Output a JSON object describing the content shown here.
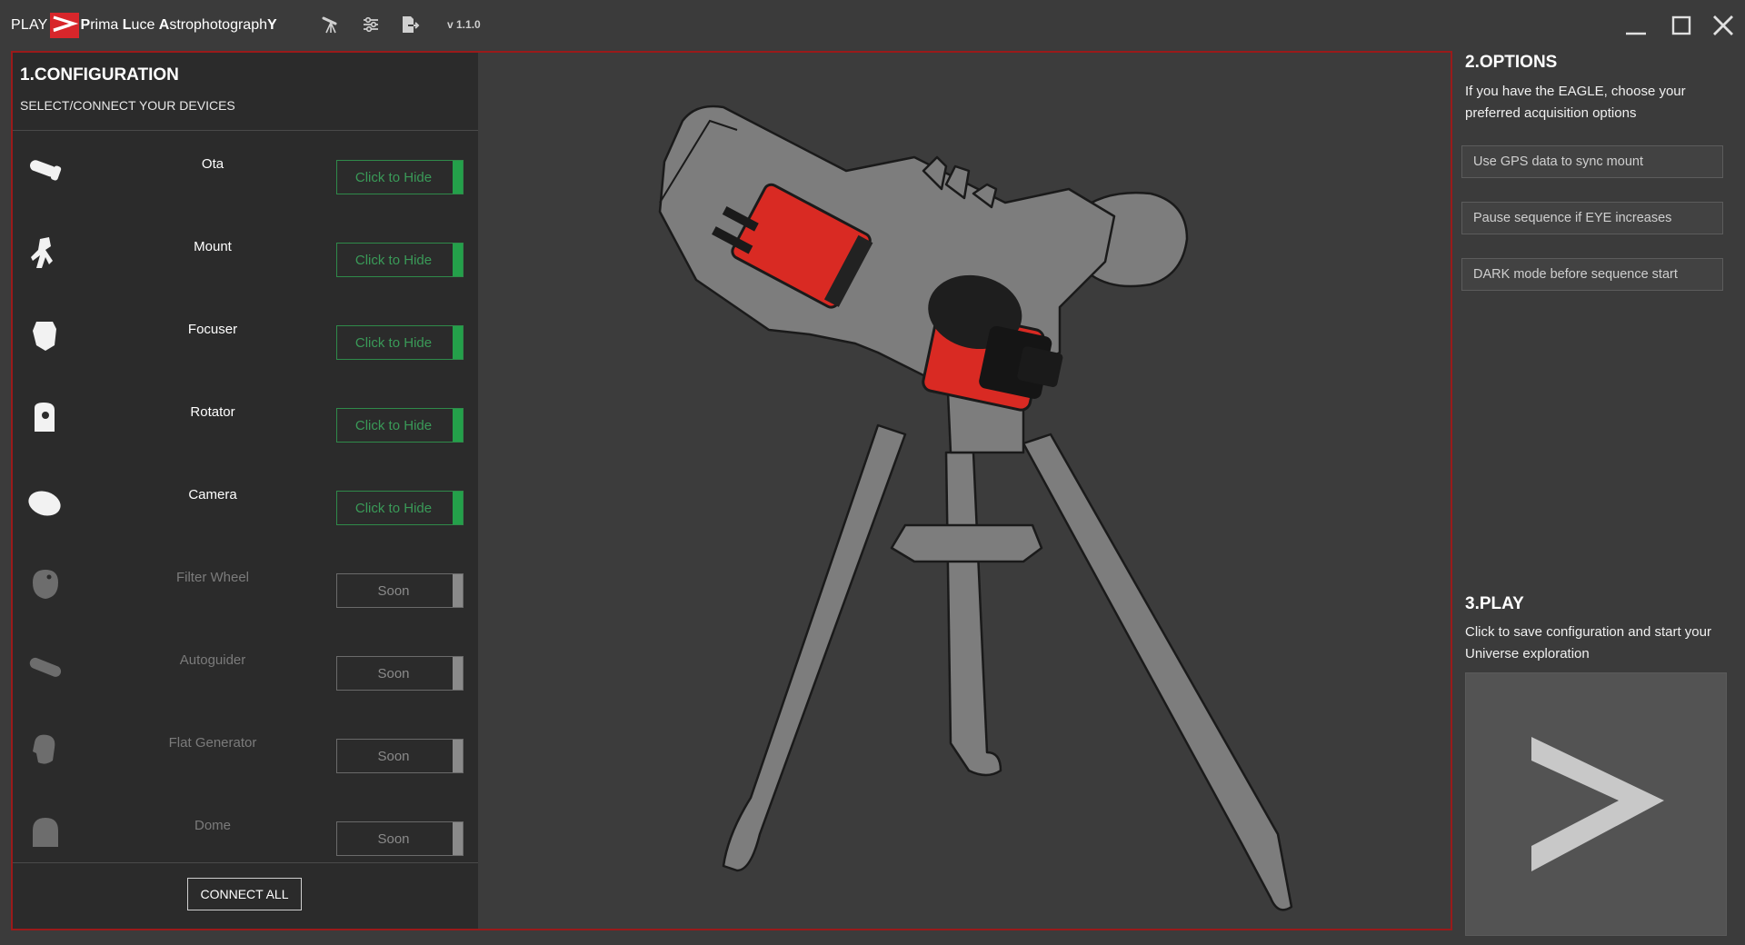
{
  "titlebar": {
    "brand_play": "PLAY",
    "brand_name_parts": [
      "P",
      "rima ",
      "L",
      "uce ",
      "A",
      "strophotograph",
      "Y"
    ],
    "version": "v 1.1.0",
    "icons": [
      "telescope-icon",
      "settings-sliders-icon",
      "export-icon"
    ],
    "window_controls": [
      "minimize-icon",
      "maximize-icon",
      "close-icon"
    ],
    "accent_color": "#d8262b"
  },
  "configuration": {
    "title": "1.CONFIGURATION",
    "subtitle": "SELECT/CONNECT YOUR DEVICES",
    "devices": [
      {
        "name": "Ota",
        "button": "Click to Hide",
        "enabled": true,
        "icon": "ota-icon"
      },
      {
        "name": "Mount",
        "button": "Click to Hide",
        "enabled": true,
        "icon": "mount-icon"
      },
      {
        "name": "Focuser",
        "button": "Click to Hide",
        "enabled": true,
        "icon": "focuser-icon"
      },
      {
        "name": "Rotator",
        "button": "Click to Hide",
        "enabled": true,
        "icon": "rotator-icon"
      },
      {
        "name": "Camera",
        "button": "Click to Hide",
        "enabled": true,
        "icon": "camera-icon"
      },
      {
        "name": "Filter Wheel",
        "button": "Soon",
        "enabled": false,
        "icon": "filter-wheel-icon"
      },
      {
        "name": "Autoguider",
        "button": "Soon",
        "enabled": false,
        "icon": "autoguider-icon"
      },
      {
        "name": "Flat Generator",
        "button": "Soon",
        "enabled": false,
        "icon": "flat-generator-icon"
      },
      {
        "name": "Dome",
        "button": "Soon",
        "enabled": false,
        "icon": "dome-icon"
      }
    ],
    "connect_all": "CONNECT ALL",
    "colors": {
      "active_green": "#24a04a",
      "soon_gray": "#8a8a8a"
    }
  },
  "options": {
    "title": "2.OPTIONS",
    "description": "If you have the EAGLE, choose your preferred acquisition options",
    "buttons": [
      "Use GPS data to sync mount",
      "Pause sequence if EYE increases",
      "DARK mode before sequence start"
    ]
  },
  "play": {
    "title": "3.PLAY",
    "description": "Click to save configuration and start your Universe exploration",
    "icon": "play-chevron-icon"
  }
}
